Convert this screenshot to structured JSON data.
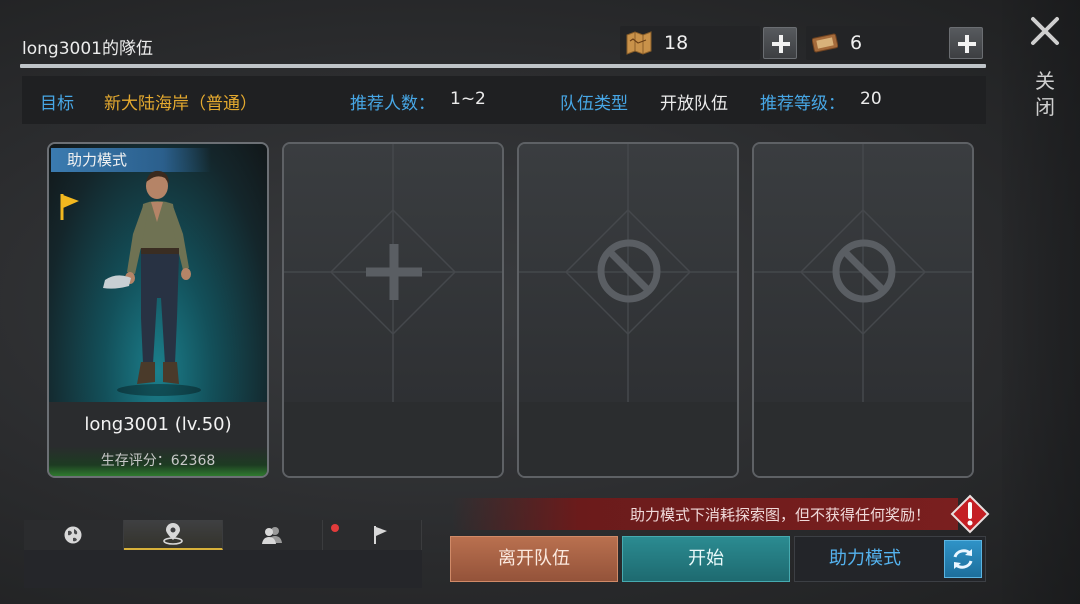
{
  "header": {
    "title": "long3001的隊伍",
    "resources": [
      {
        "icon": "map-icon",
        "value": "18"
      },
      {
        "icon": "ticket-icon",
        "value": "6"
      }
    ]
  },
  "close": {
    "label": "关闭"
  },
  "info": {
    "target_label": "目标",
    "target_value": "新大陆海岸（普通）",
    "recommend_players_label": "推荐人数：",
    "recommend_players_value": "1~2",
    "team_type_label": "队伍类型",
    "team_type_value": "开放队伍",
    "recommend_level_label": "推荐等级：",
    "recommend_level_value": "20"
  },
  "slots": [
    {
      "type": "player",
      "mode_tag": "助力模式",
      "name": "long3001 (lv.50)",
      "score": "生存评分：62368"
    },
    {
      "type": "add"
    },
    {
      "type": "locked"
    },
    {
      "type": "locked"
    }
  ],
  "tabs": [
    {
      "icon": "globe-icon",
      "active": false
    },
    {
      "icon": "location-pin-icon",
      "active": true
    },
    {
      "icon": "friends-icon",
      "active": false
    },
    {
      "icon": "flag-icon",
      "active": false,
      "notification": true
    }
  ],
  "warning": {
    "text": "助力模式下消耗探索图，但不获得任何奖励！"
  },
  "buttons": {
    "leave": "离开队伍",
    "start": "开始",
    "assist": "助力模式"
  },
  "colors": {
    "accent_blue": "#47a7e6",
    "target_yellow": "#e4a92f",
    "leave_orange": "#b9704f",
    "start_teal": "#2b8b91",
    "warning_red": "#7a1f1f"
  }
}
